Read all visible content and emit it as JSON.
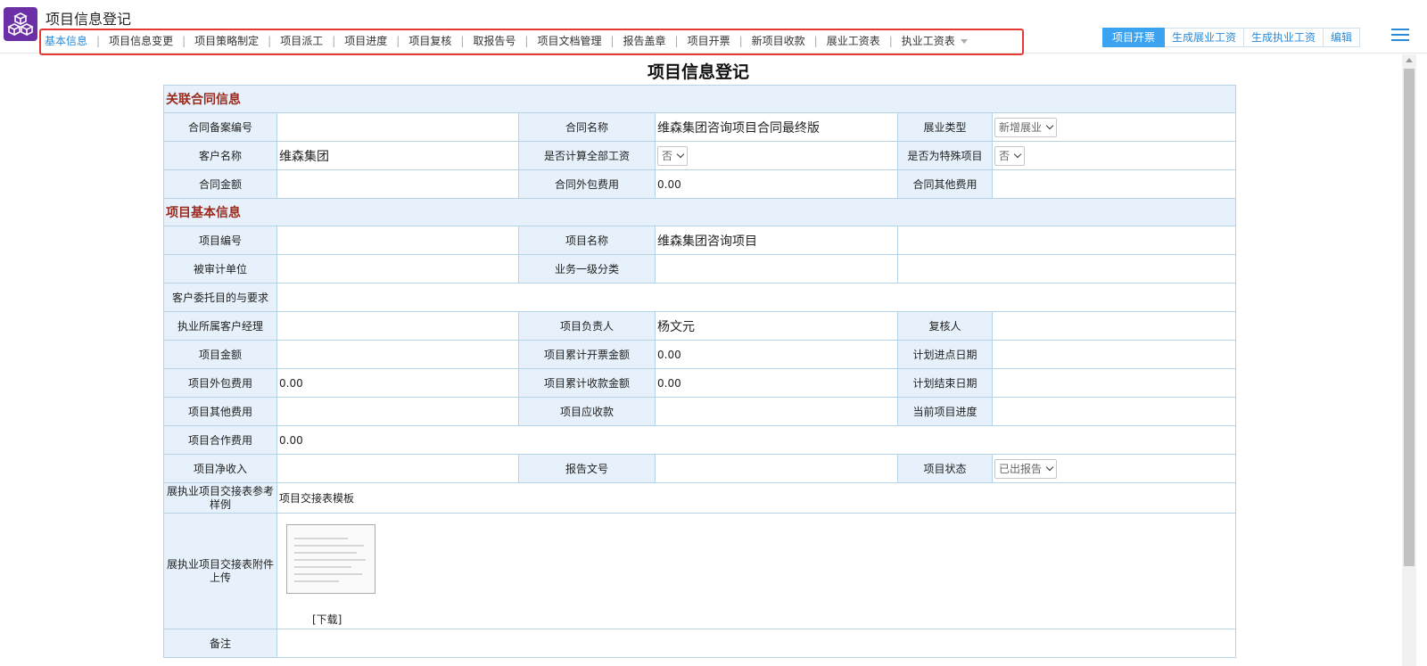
{
  "app": {
    "title": "项目信息登记"
  },
  "nav": {
    "tabs": [
      {
        "label": "基本信息"
      },
      {
        "label": "项目信息变更"
      },
      {
        "label": "项目策略制定"
      },
      {
        "label": "项目派工"
      },
      {
        "label": "项目进度"
      },
      {
        "label": "项目复核"
      },
      {
        "label": "取报告号"
      },
      {
        "label": "项目文档管理"
      },
      {
        "label": "报告盖章"
      },
      {
        "label": "项目开票"
      },
      {
        "label": "新项目收款"
      },
      {
        "label": "展业工资表"
      },
      {
        "label": "执业工资表"
      }
    ]
  },
  "actions": {
    "invoice": "项目开票",
    "gen_zhanye": "生成展业工资",
    "gen_zhiye": "生成执业工资",
    "edit": "编辑"
  },
  "page": {
    "title": "项目信息登记"
  },
  "sections": {
    "contract": "关联合同信息",
    "project": "项目基本信息"
  },
  "fields": {
    "contract_record_no": {
      "label": "合同备案编号",
      "value": ""
    },
    "contract_name": {
      "label": "合同名称",
      "value": "维森集团咨询项目合同最终版"
    },
    "business_type": {
      "label": "展业类型",
      "value": "新增展业"
    },
    "client_name": {
      "label": "客户名称",
      "value": "维森集团"
    },
    "calc_all_wages": {
      "label": "是否计算全部工资",
      "value": "否"
    },
    "special_project": {
      "label": "是否为特殊项目",
      "value": "否"
    },
    "contract_amount": {
      "label": "合同金额",
      "value": ""
    },
    "contract_outsource": {
      "label": "合同外包费用",
      "value": "0.00"
    },
    "contract_other": {
      "label": "合同其他费用",
      "value": ""
    },
    "project_no": {
      "label": "项目编号",
      "value": ""
    },
    "project_name": {
      "label": "项目名称",
      "value": "维森集团咨询项目"
    },
    "audited_unit": {
      "label": "被审计单位",
      "value": ""
    },
    "business_category": {
      "label": "业务一级分类",
      "value": ""
    },
    "client_purpose": {
      "label": "客户委托目的与要求",
      "value": ""
    },
    "account_manager": {
      "label": "执业所属客户经理",
      "value": ""
    },
    "project_leader": {
      "label": "项目负责人",
      "value": "杨文元"
    },
    "reviewer": {
      "label": "复核人",
      "value": ""
    },
    "project_amount": {
      "label": "项目金额",
      "value": ""
    },
    "invoiced_total": {
      "label": "项目累计开票金额",
      "value": "0.00"
    },
    "planned_start": {
      "label": "计划进点日期",
      "value": ""
    },
    "project_outsource": {
      "label": "项目外包费用",
      "value": "0.00"
    },
    "received_total": {
      "label": "项目累计收款金额",
      "value": "0.00"
    },
    "planned_end": {
      "label": "计划结束日期",
      "value": ""
    },
    "project_other": {
      "label": "项目其他费用",
      "value": ""
    },
    "receivable": {
      "label": "项目应收款",
      "value": ""
    },
    "current_progress": {
      "label": "当前项目进度",
      "value": ""
    },
    "coop_fee": {
      "label": "项目合作费用",
      "value": "0.00"
    },
    "net_income": {
      "label": "项目净收入",
      "value": ""
    },
    "report_no": {
      "label": "报告文号",
      "value": ""
    },
    "project_status": {
      "label": "项目状态",
      "value": "已出报告"
    },
    "handover_sample": {
      "label": "展执业项目交接表参考样例",
      "value": "项目交接表模板"
    },
    "handover_upload": {
      "label": "展执业项目交接表附件上传",
      "download": "[下载]"
    },
    "remark": {
      "label": "备注",
      "value": ""
    }
  },
  "colors": {
    "accent": "#2a8ad8",
    "primary_button": "#3ba3f0",
    "section_title": "#9b2a1d",
    "label_bg": "#e6f1fb",
    "border": "#b6d2e6",
    "highlight": "#e53935",
    "logo": "#6b2fa6"
  }
}
